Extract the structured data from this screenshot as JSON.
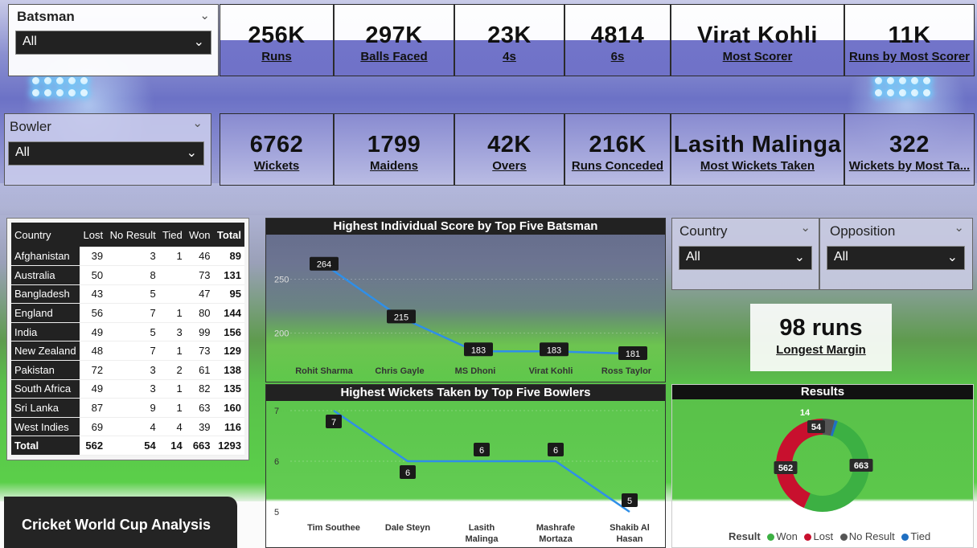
{
  "slicers": {
    "batsman": {
      "title": "Batsman",
      "value": "All"
    },
    "bowler": {
      "title": "Bowler",
      "value": "All"
    },
    "country": {
      "title": "Country",
      "value": "All"
    },
    "opposition": {
      "title": "Opposition",
      "value": "All"
    }
  },
  "batting_cards": [
    {
      "value": "256K",
      "label": "Runs"
    },
    {
      "value": "297K",
      "label": "Balls Faced"
    },
    {
      "value": "23K",
      "label": "4s"
    },
    {
      "value": "4814",
      "label": "6s"
    },
    {
      "value": "Virat Kohli",
      "label": "Most Scorer"
    },
    {
      "value": "11K",
      "label": "Runs by Most Scorer"
    }
  ],
  "bowling_cards": [
    {
      "value": "6762",
      "label": "Wickets"
    },
    {
      "value": "1799",
      "label": "Maidens"
    },
    {
      "value": "42K",
      "label": "Overs"
    },
    {
      "value": "216K",
      "label": "Runs Conceded"
    },
    {
      "value": "Lasith Malinga",
      "label": "Most Wickets Taken"
    },
    {
      "value": "322",
      "label": "Wickets by Most Ta..."
    }
  ],
  "table": {
    "headers": [
      "Country",
      "Lost",
      "No Result",
      "Tied",
      "Won",
      "Total"
    ],
    "rows": [
      [
        "Afghanistan",
        "39",
        "3",
        "1",
        "46",
        "89"
      ],
      [
        "Australia",
        "50",
        "8",
        "",
        "73",
        "131"
      ],
      [
        "Bangladesh",
        "43",
        "5",
        "",
        "47",
        "95"
      ],
      [
        "England",
        "56",
        "7",
        "1",
        "80",
        "144"
      ],
      [
        "India",
        "49",
        "5",
        "3",
        "99",
        "156"
      ],
      [
        "New Zealand",
        "48",
        "7",
        "1",
        "73",
        "129"
      ],
      [
        "Pakistan",
        "72",
        "3",
        "2",
        "61",
        "138"
      ],
      [
        "South Africa",
        "49",
        "3",
        "1",
        "82",
        "135"
      ],
      [
        "Sri Lanka",
        "87",
        "9",
        "1",
        "63",
        "160"
      ],
      [
        "West Indies",
        "69",
        "4",
        "4",
        "39",
        "116"
      ]
    ],
    "total": [
      "Total",
      "562",
      "54",
      "14",
      "663",
      "1293"
    ]
  },
  "longest_margin": {
    "value": "98 runs",
    "label": "Longest Margin"
  },
  "banner": "Cricket World Cup Analysis",
  "chart_data": [
    {
      "type": "line",
      "title": "Highest Individual Score by Top Five Batsman",
      "categories": [
        "Rohit Sharma",
        "Chris Gayle",
        "MS Dhoni",
        "Virat Kohli",
        "Ross Taylor"
      ],
      "values": [
        264,
        215,
        183,
        183,
        181
      ],
      "yticks": [
        200,
        250
      ],
      "ylim": [
        175,
        275
      ],
      "color": "#2f8fe8"
    },
    {
      "type": "line",
      "title": "Highest Wickets Taken by Top Five Bowlers",
      "categories": [
        "Tim Southee",
        "Dale Steyn",
        "Lasith Malinga",
        "Mashrafe Mortaza",
        "Shakib Al Hasan"
      ],
      "values": [
        7,
        6,
        6,
        6,
        5
      ],
      "yticks": [
        5,
        6,
        7
      ],
      "ylim": [
        5,
        7
      ],
      "color": "#2f8fe8"
    },
    {
      "type": "pie",
      "title": "Results",
      "legend_title": "Result",
      "categories": [
        "Won",
        "Lost",
        "No Result",
        "Tied"
      ],
      "values": [
        663,
        562,
        54,
        14
      ],
      "colors": [
        "#3cb043",
        "#c8102e",
        "#555555",
        "#1f6fc2"
      ]
    }
  ]
}
